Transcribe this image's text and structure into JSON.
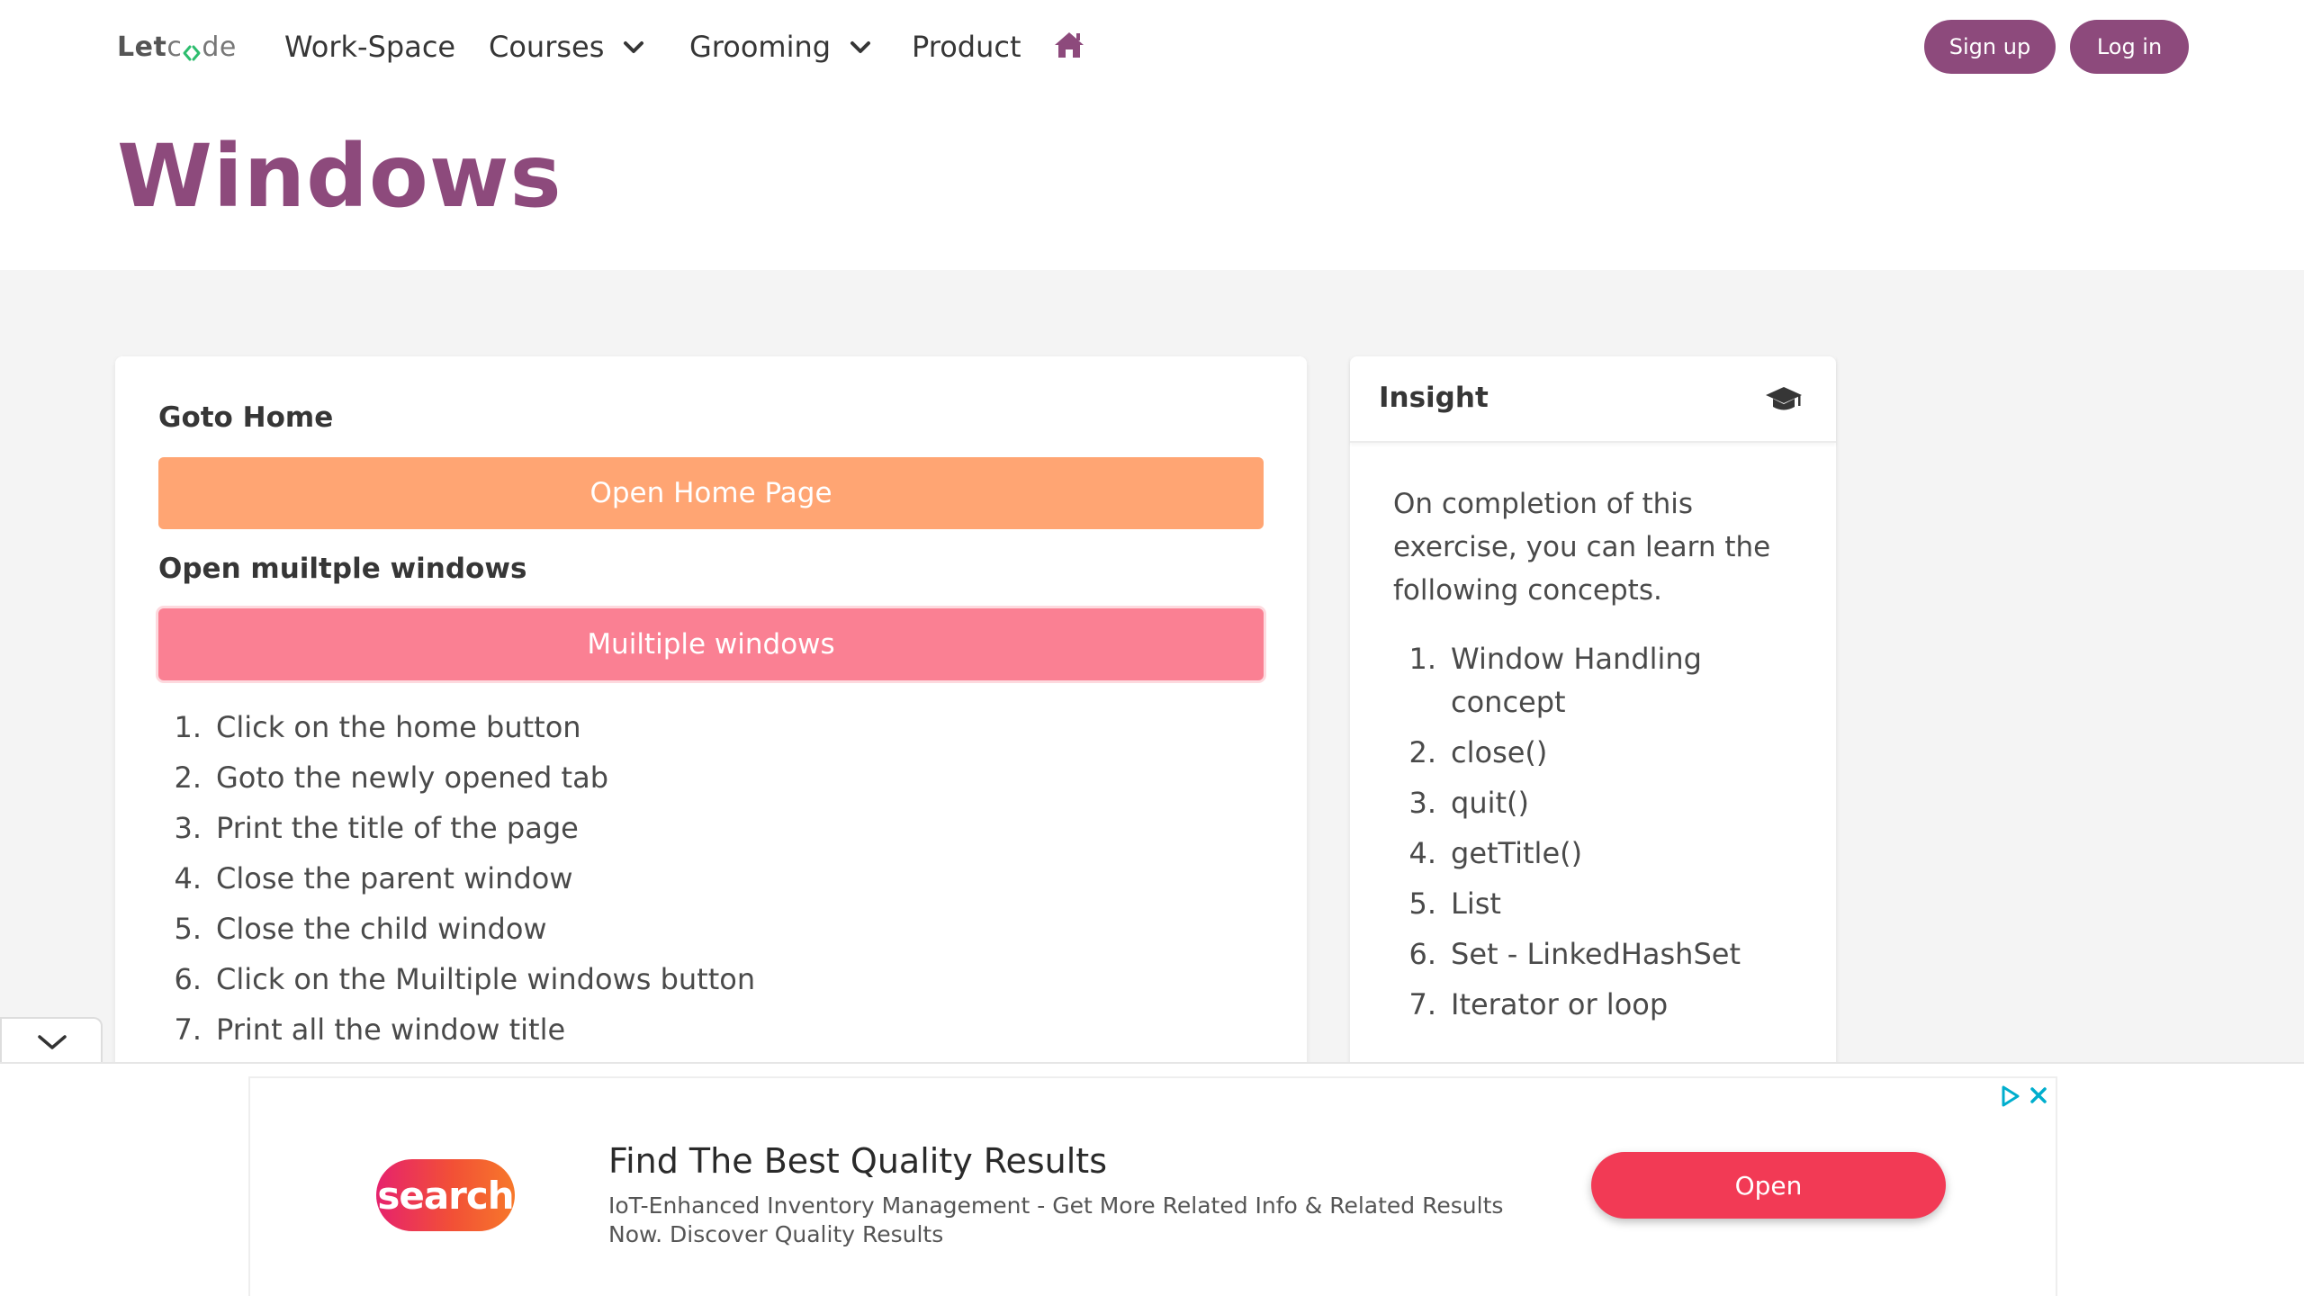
{
  "brand": {
    "logo_prefix": "Let",
    "logo_c": "c",
    "logo_suffix": "de",
    "logo_aria": "Letcode"
  },
  "nav": {
    "items": [
      {
        "label": "Work-Space"
      },
      {
        "label": "Courses"
      },
      {
        "label": "Grooming"
      },
      {
        "label": "Product"
      }
    ],
    "home_icon": "home-icon",
    "signup_label": "Sign up",
    "login_label": "Log in"
  },
  "page": {
    "title": "Windows"
  },
  "main": {
    "goto_home_label": "Goto Home",
    "open_home_button": "Open Home Page",
    "multiple_label": "Open muiltple windows",
    "multiple_button": "Muiltiple windows",
    "steps": [
      {
        "num": "1.",
        "text": "Click on the home button"
      },
      {
        "num": "2.",
        "text": "Goto the newly opened tab"
      },
      {
        "num": "3.",
        "text": "Print the title of the page"
      },
      {
        "num": "4.",
        "text": "Close the parent window"
      },
      {
        "num": "5.",
        "text": "Close the child window"
      },
      {
        "num": "6.",
        "text": "Click on the Muiltiple windows button"
      },
      {
        "num": "7.",
        "text": "Print all the window title"
      }
    ]
  },
  "insight": {
    "title": "Insight",
    "icon": "graduation-cap-icon",
    "description": "On completion of this exercise, you can learn the following concepts.",
    "concepts": [
      {
        "num": "1.",
        "text": "Window Handling concept"
      },
      {
        "num": "2.",
        "text": "close()"
      },
      {
        "num": "3.",
        "text": "quit()"
      },
      {
        "num": "4.",
        "text": "getTitle()"
      },
      {
        "num": "5.",
        "text": "List"
      },
      {
        "num": "6.",
        "text": "Set - LinkedHashSet"
      },
      {
        "num": "7.",
        "text": "Iterator or loop"
      }
    ]
  },
  "ad": {
    "logo_text": "search",
    "headline": "Find The Best Quality Results",
    "body": "IoT-Enhanced Inventory Management - Get More Related Info & Related Results Now. Discover Quality Results",
    "cta": "Open"
  },
  "colors": {
    "brand": "#8d4a7c",
    "home_button": "#ffa573",
    "multiple_button": "#fa8093",
    "ad_cta": "#f23a55",
    "logo_accent": "#2dbd6e"
  }
}
